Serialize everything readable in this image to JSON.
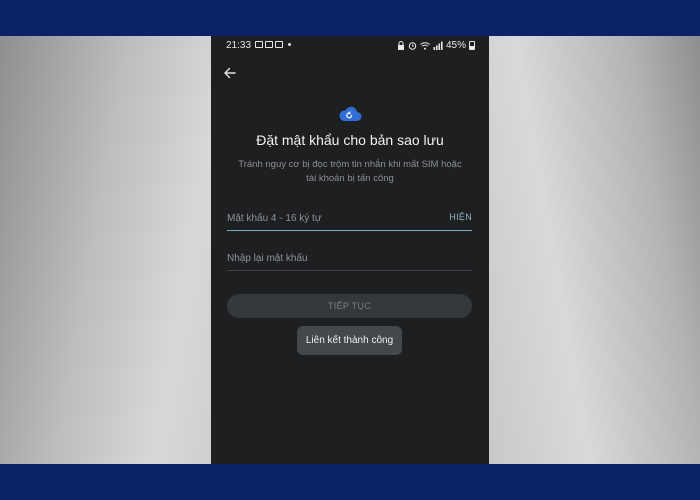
{
  "status_bar": {
    "time": "21:33",
    "battery": "45%"
  },
  "screen": {
    "title": "Đặt mật khẩu cho bản sao lưu",
    "subtitle": "Tránh nguy cơ bị đọc trộm tin nhắn khi mất SIM hoặc tài khoản bị tấn công",
    "password_field": {
      "placeholder": "Mật khẩu 4 - 16 ký tự",
      "value": "",
      "show_label": "HIỆN"
    },
    "confirm_field": {
      "placeholder": "Nhập lại mật khẩu",
      "value": ""
    },
    "continue_label": "TIẾP TỤC",
    "toast": "Liên kết thành công"
  },
  "icons": {
    "back": "arrow-left-icon",
    "cloud": "cloud-backup-icon"
  },
  "colors": {
    "accent_line": "#6fb1c4",
    "cloud_blue": "#2f6fd6",
    "frame_border": "#0b2168",
    "screen_bg": "#1e1f21"
  }
}
